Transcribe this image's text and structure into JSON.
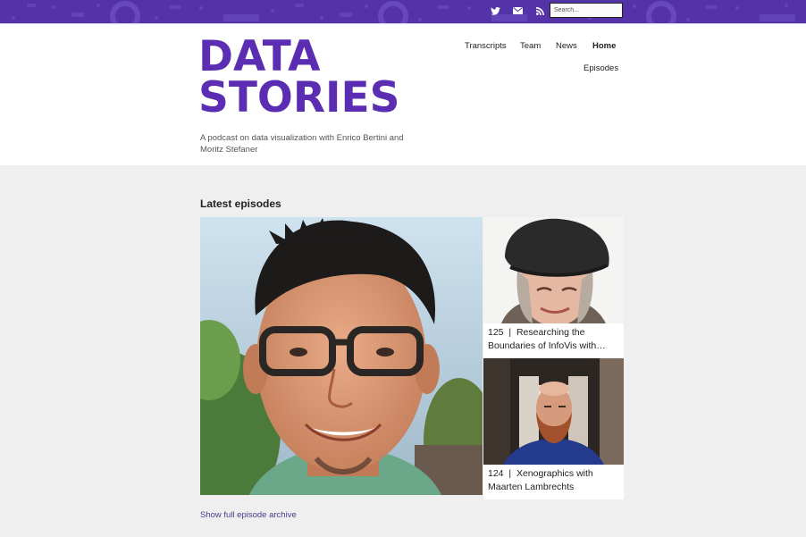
{
  "topbar": {
    "bg_color": "#5432a8",
    "icons": [
      "twitter-icon",
      "mail-icon",
      "rss-icon"
    ],
    "search_placeholder": "Search..."
  },
  "header": {
    "logo_line1": "DATA",
    "logo_line2": "STORIES",
    "logo_color": "#5a2db2",
    "tagline": "A podcast on data visualization with Enrico Bertini and Moritz Stefaner",
    "nav": {
      "transcripts": "Transcripts",
      "team": "Team",
      "news": "News",
      "home": "Home",
      "episodes": "Episodes"
    }
  },
  "main": {
    "section_title": "Latest episodes",
    "episodes": [
      {
        "number": "125",
        "separator": "|",
        "title": "Researching the Boundaries of InfoVis with…"
      },
      {
        "number": "124",
        "separator": "|",
        "title": "Xenographics with Maarten Lambrechts"
      }
    ],
    "archive_link": "Show full episode archive"
  }
}
